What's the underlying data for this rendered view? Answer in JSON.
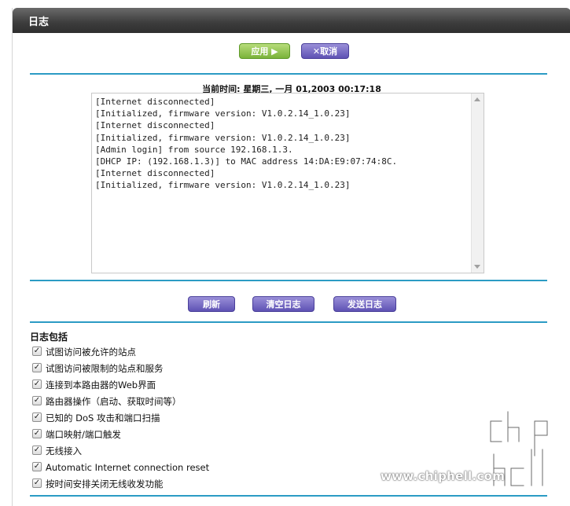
{
  "header": {
    "title": "日志"
  },
  "actions": {
    "apply_label": "应用 ▶",
    "cancel_label": "✕取消"
  },
  "time": {
    "label": "当前时间: 星期三, 一月 01,2003 00:17:18"
  },
  "log": {
    "lines": [
      "[Internet disconnected]",
      "[Initialized, firmware version: V1.0.2.14_1.0.23]",
      "[Internet disconnected]",
      "[Initialized, firmware version: V1.0.2.14_1.0.23]",
      "[Admin login] from source 192.168.1.3.",
      "[DHCP IP: (192.168.1.3)] to MAC address 14:DA:E9:07:74:8C.",
      "[Internet disconnected]",
      "[Initialized, firmware version: V1.0.2.14_1.0.23]"
    ]
  },
  "log_buttons": {
    "refresh_label": "刷新",
    "clear_label": "清空日志",
    "send_label": "发送日志"
  },
  "includes": {
    "title": "日志包括",
    "options": [
      {
        "label": "试图访问被允许的站点",
        "checked": true
      },
      {
        "label": "试图访问被限制的站点和服务",
        "checked": true
      },
      {
        "label": "连接到本路由器的Web界面",
        "checked": true
      },
      {
        "label": "路由器操作（启动、获取时间等）",
        "checked": true
      },
      {
        "label": "已知的 DoS 攻击和端口扫描",
        "checked": true
      },
      {
        "label": "端口映射/端口触发",
        "checked": true
      },
      {
        "label": "无线接入",
        "checked": true
      },
      {
        "label": "Automatic Internet connection reset",
        "checked": true
      },
      {
        "label": "按时间安排关闭无线收发功能",
        "checked": true
      }
    ]
  },
  "watermark": {
    "url": "www.chiphell.com",
    "logo": "chip hell"
  },
  "colors": {
    "accent_line": "#2b9bc4",
    "apply_green": "#7ab33a",
    "button_purple": "#5e52b4",
    "titlebar": "#3c3c3c"
  }
}
